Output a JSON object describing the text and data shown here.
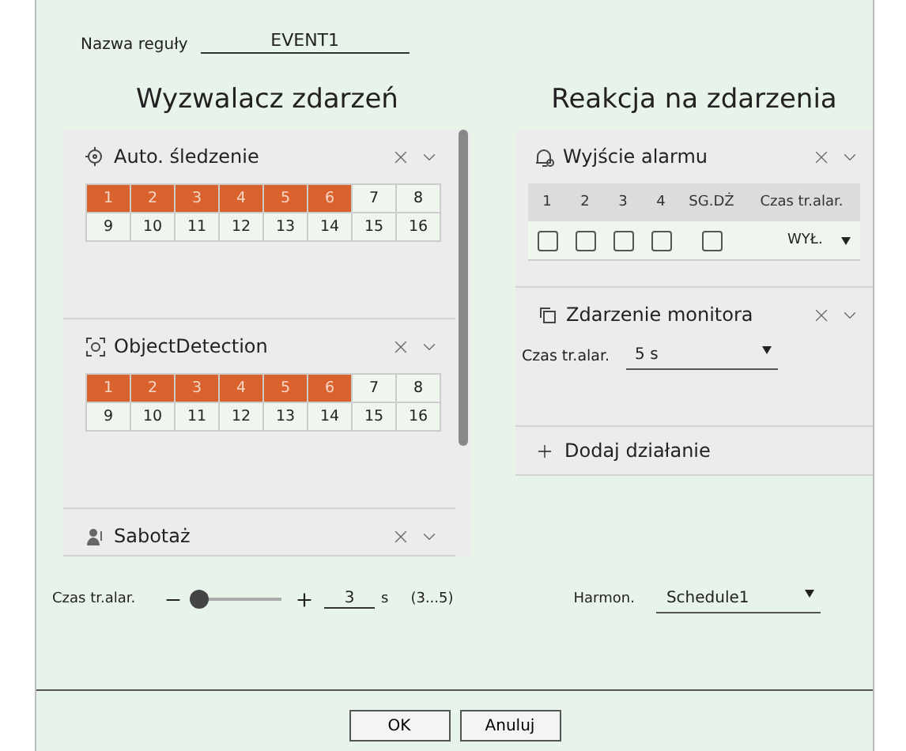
{
  "rule_name": {
    "label": "Nazwa reguły",
    "value": "EVENT1"
  },
  "triggers_title": "Wyzwalacz zdarzeń",
  "reactions_title": "Reakcja na zdarzenia",
  "triggers": [
    {
      "kind": "tracking",
      "name": "Auto. śledzenie",
      "channels": [
        {
          "label": "1",
          "selected": true
        },
        {
          "label": "2",
          "selected": true
        },
        {
          "label": "3",
          "selected": true
        },
        {
          "label": "4",
          "selected": true
        },
        {
          "label": "5",
          "selected": true
        },
        {
          "label": "6",
          "selected": true
        },
        {
          "label": "7",
          "selected": false
        },
        {
          "label": "8",
          "selected": false
        },
        {
          "label": "9",
          "selected": false
        },
        {
          "label": "10",
          "selected": false
        },
        {
          "label": "11",
          "selected": false
        },
        {
          "label": "12",
          "selected": false
        },
        {
          "label": "13",
          "selected": false
        },
        {
          "label": "14",
          "selected": false
        },
        {
          "label": "15",
          "selected": false
        },
        {
          "label": "16",
          "selected": false
        }
      ]
    },
    {
      "kind": "object",
      "name": "ObjectDetection",
      "channels": [
        {
          "label": "1",
          "selected": true
        },
        {
          "label": "2",
          "selected": true
        },
        {
          "label": "3",
          "selected": true
        },
        {
          "label": "4",
          "selected": true
        },
        {
          "label": "5",
          "selected": true
        },
        {
          "label": "6",
          "selected": true
        },
        {
          "label": "7",
          "selected": false
        },
        {
          "label": "8",
          "selected": false
        },
        {
          "label": "9",
          "selected": false
        },
        {
          "label": "10",
          "selected": false
        },
        {
          "label": "11",
          "selected": false
        },
        {
          "label": "12",
          "selected": false
        },
        {
          "label": "13",
          "selected": false
        },
        {
          "label": "14",
          "selected": false
        },
        {
          "label": "15",
          "selected": false
        },
        {
          "label": "16",
          "selected": false
        }
      ]
    },
    {
      "kind": "tamper",
      "name": "Sabotaż"
    }
  ],
  "alarm_output": {
    "title": "Wyjście alarmu",
    "columns": [
      "1",
      "2",
      "3",
      "4",
      "SG.DŻ",
      "Czas tr.alar."
    ],
    "outputs": [
      {
        "checked": false
      },
      {
        "checked": false
      },
      {
        "checked": false
      },
      {
        "checked": false
      },
      {
        "checked": false
      }
    ],
    "duration": "WYŁ."
  },
  "monitor_event": {
    "title": "Zdarzenie monitora",
    "label": "Czas tr.alar.",
    "value": "5 s"
  },
  "add_action": "Dodaj działanie",
  "alarm_time": {
    "label": "Czas tr.alar.",
    "level": 0,
    "value": "3",
    "unit": "s",
    "range": "(3...5)"
  },
  "schedule": {
    "label": "Harmon.",
    "value": "Schedule1"
  },
  "buttons": [
    "OK",
    "Anuluj"
  ]
}
